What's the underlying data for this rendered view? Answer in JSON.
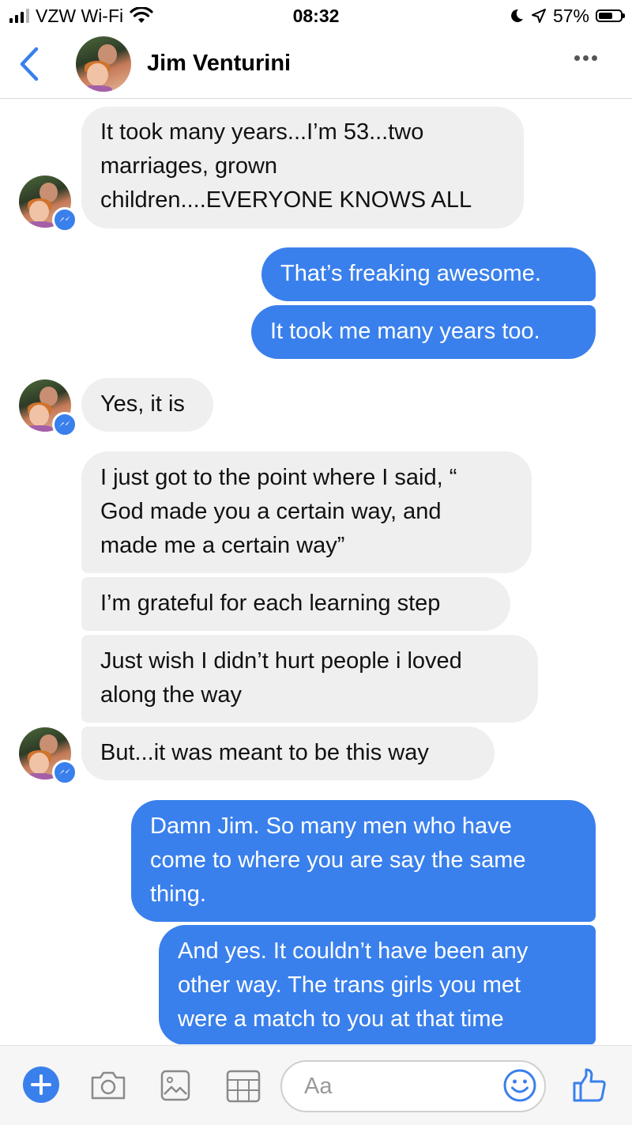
{
  "status_bar": {
    "carrier": "VZW Wi-Fi",
    "time": "08:32",
    "battery": "57%",
    "battery_level": 0.57,
    "icons": [
      "signal-icon",
      "wifi-icon",
      "moon-icon",
      "location-arrow-icon",
      "battery-icon"
    ]
  },
  "header": {
    "contact_name": "Jim Venturini",
    "icons": [
      "back-chevron-icon",
      "contact-avatar",
      "more-options-icon"
    ]
  },
  "messages": [
    {
      "sender": "contact",
      "text": "It took many years...I’m 53...two\nmarriages, grown\nchildren....EVERYONE KNOWS ALL"
    },
    {
      "sender": "me",
      "text": "That’s freaking awesome."
    },
    {
      "sender": "me",
      "text": "It took me many years too."
    },
    {
      "sender": "contact",
      "text": "Yes, it is"
    },
    {
      "sender": "contact",
      "text": "I just got to the point where I said, “\nGod made you a certain way, and\nmade me a certain way”"
    },
    {
      "sender": "contact",
      "text": "I’m grateful for each learning step"
    },
    {
      "sender": "contact",
      "text": "Just wish I didn’t hurt people i loved\nalong the way"
    },
    {
      "sender": "contact",
      "text": "But...it was meant to be this way"
    },
    {
      "sender": "me",
      "text": "Damn Jim. So many men who have\ncome to where you are say the same\nthing."
    },
    {
      "sender": "me",
      "text": "And yes. It couldn’t have been any\nother way. The trans girls you met\nwere a match to you at that time"
    }
  ],
  "composer": {
    "placeholder": "Aa",
    "icons": [
      "plus-icon",
      "camera-icon",
      "photo-gallery-icon",
      "gif-sticker-icon",
      "emoji-icon",
      "thumbs-up-icon"
    ]
  },
  "colors": {
    "accent_blue": "#3a80ec",
    "incoming_bubble": "#efefef",
    "outgoing_text": "#ffffff"
  }
}
